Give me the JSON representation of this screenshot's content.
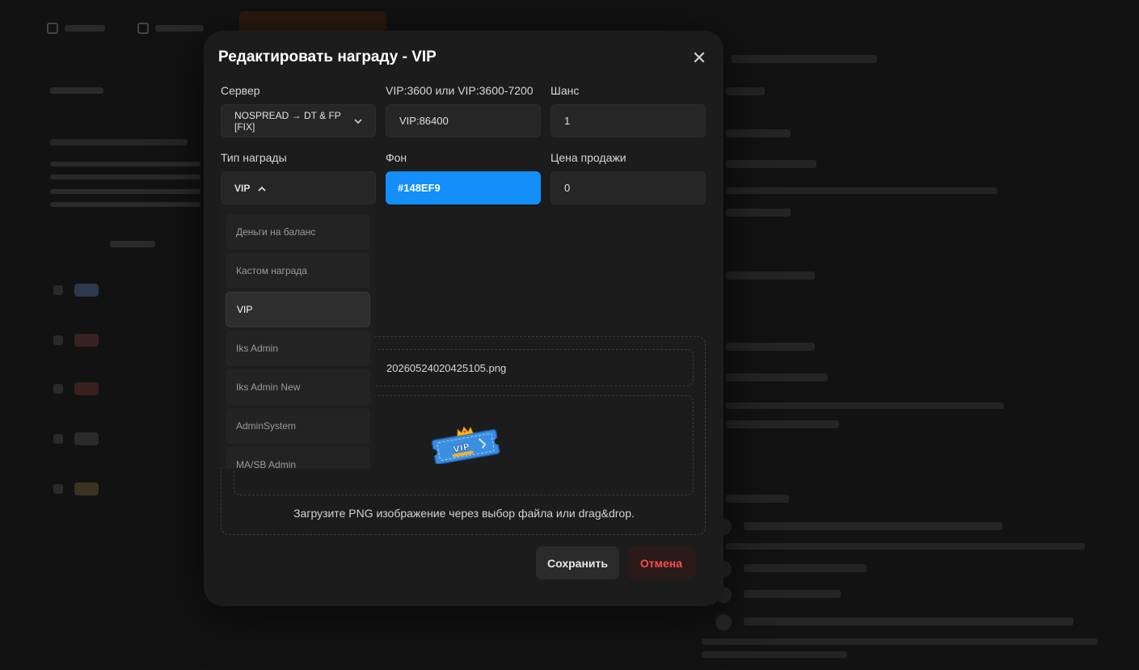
{
  "modal": {
    "title": "Редактировать награду - VIP",
    "close_label": "✕",
    "fields": {
      "server": {
        "label": "Сервер",
        "value": "NOSPREAD → DT & FP [FIX]"
      },
      "vip_time": {
        "label": "VIP:3600 или VIP:3600-7200",
        "value": "VIP:86400"
      },
      "chance": {
        "label": "Шанс",
        "value": "1"
      },
      "reward_type": {
        "label": "Тип награды",
        "value": "VIP"
      },
      "background": {
        "label": "Фон",
        "value": "#148EF9",
        "color": "#148EF9"
      },
      "sale_price": {
        "label": "Цена продажи",
        "value": "0"
      }
    },
    "reward_type_options": [
      "Деньги на баланс",
      "Кастом награда",
      "VIP",
      "Iks Admin",
      "Iks Admin New",
      "AdminSystem",
      "MA/SB Admin"
    ],
    "selected_option": "VIP",
    "upload": {
      "file_name": "20260524020425105.png",
      "hint": "Загрузите PNG изображение через выбор файла или drag&drop.",
      "preview_icon": "vip-ticket-icon"
    },
    "buttons": {
      "save": "Сохранить",
      "cancel": "Отмена"
    }
  },
  "colors": {
    "accent": "#148EF9",
    "cancel_text": "#FF4B4B",
    "modal_bg": "#1C1C1C"
  }
}
